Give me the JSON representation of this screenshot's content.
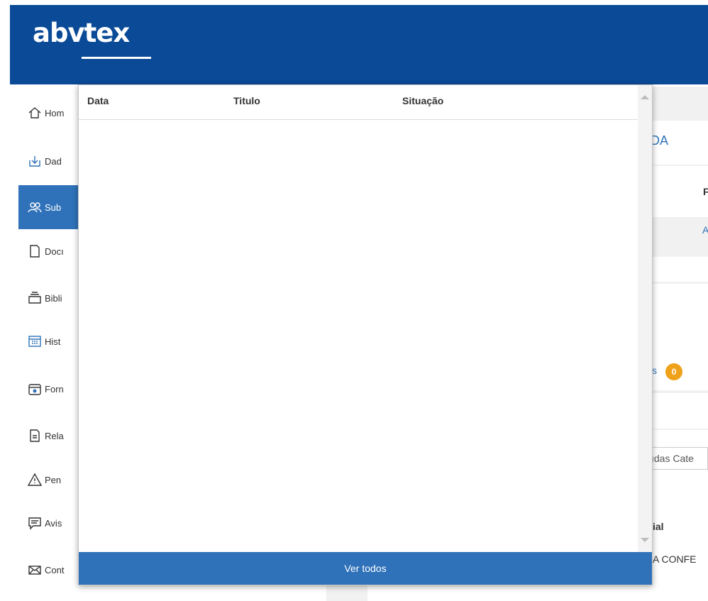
{
  "header": {
    "logo_text": "abvtex",
    "brand_color": "#0a4a96"
  },
  "sidebar": {
    "items": [
      {
        "label": "Hom",
        "icon": "home-icon"
      },
      {
        "label": "Dad",
        "icon": "download-icon"
      },
      {
        "label": "Sub",
        "icon": "users-icon",
        "active": true
      },
      {
        "label": "Docı",
        "icon": "document-icon"
      },
      {
        "label": "Bibli",
        "icon": "library-icon"
      },
      {
        "label": "Hist",
        "icon": "calendar-icon"
      },
      {
        "label": "Forn",
        "icon": "supplier-icon"
      },
      {
        "label": "Rela",
        "icon": "report-icon"
      },
      {
        "label": "Pen",
        "icon": "warning-icon"
      },
      {
        "label": "Avis",
        "icon": "notice-icon"
      },
      {
        "label": "Cont",
        "icon": "mail-icon"
      }
    ]
  },
  "background": {
    "title_fragment": "DA",
    "col_fragment": "F",
    "link_fragment": "A",
    "badge_prefix": "s",
    "badge_count": "0",
    "select_fragment": "ıdas Cate",
    "table_header_fragment": "ial",
    "row_fragment": "A CONFE"
  },
  "popup": {
    "columns": [
      "Data",
      "Titulo",
      "Situação"
    ],
    "rows": [],
    "footer_button": "Ver todos",
    "accent": "#2f72b9"
  }
}
